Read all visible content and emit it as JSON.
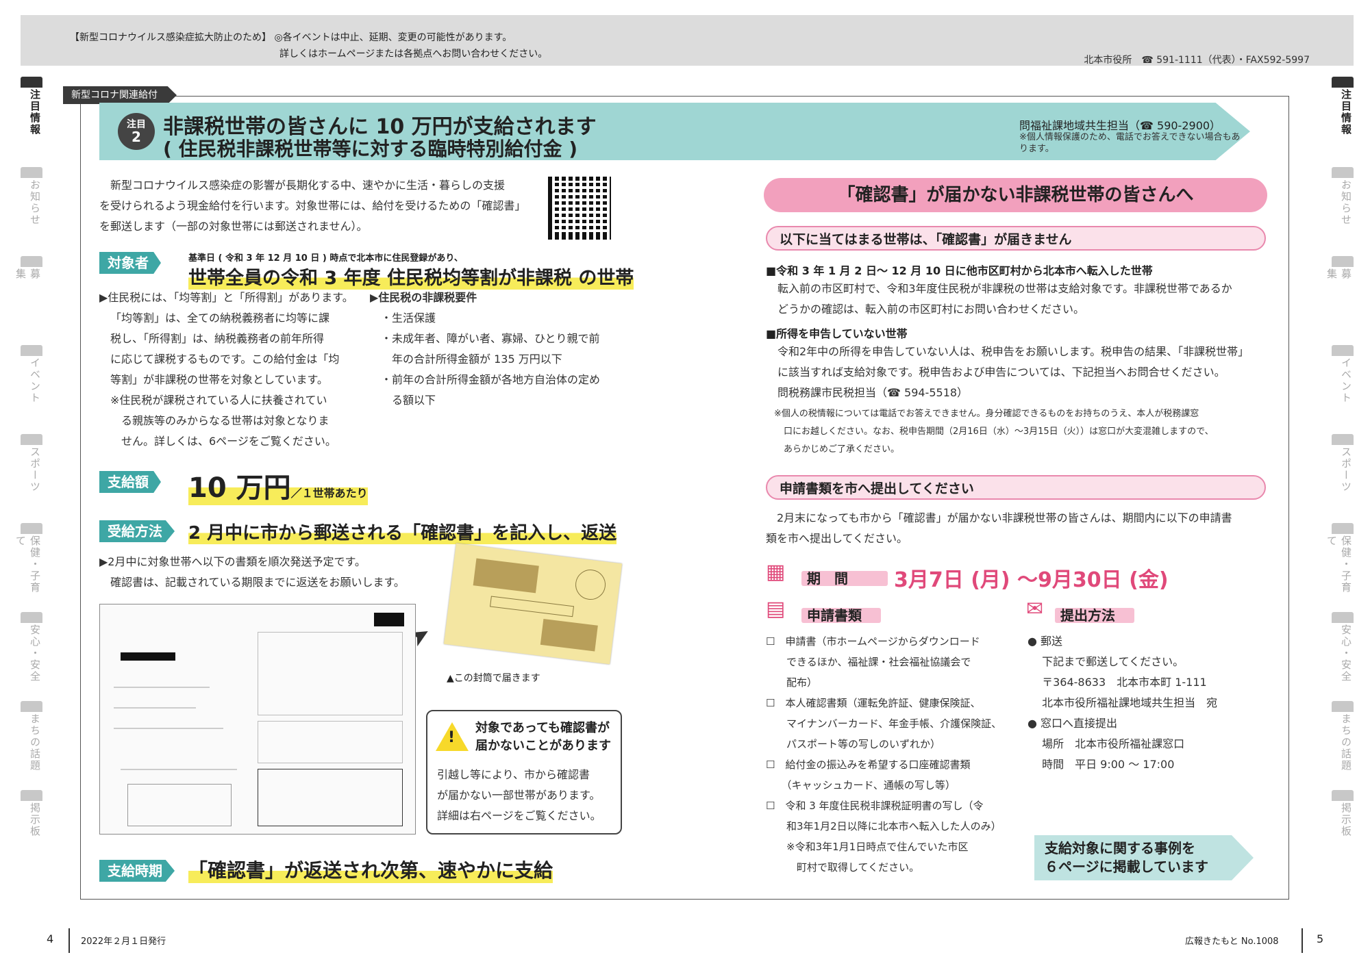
{
  "top_notice": {
    "line1": "【新型コロナウイルス感染症拡大防止のため】 ◎各イベントは中止、延期、変更の可能性があります。",
    "line2": "詳しくはホームページまたは各拠点へお問い合わせください。",
    "city_contact": "北本市役所　☎ 591-1111（代表）・FAX592-5997"
  },
  "side_tabs": [
    "注目情報",
    "お知らせ",
    "募集",
    "イベント",
    "スポーツ",
    "保健・子育て",
    "安心・安全",
    "まちの話題",
    "掲示板"
  ],
  "section_label": "新型コロナ関連給付",
  "header": {
    "badge_top": "注目",
    "badge_num": "2",
    "title1": "非課税世帯の皆さんに 10 万円が支給されます",
    "title2": "( 住民税非課税世帯等に対する臨時特別給付金 )",
    "contact": "問福祉課地域共生担当（☎ 590-2900）",
    "note": "※個人情報保護のため、電話でお答えできない場合もあります。"
  },
  "intro": {
    "line1": "新型コロナウイルス感染症の影響が長期化する中、速やかに生活・暮らしの支援",
    "line2": "を受けられるよう現金給付を行います。対象世帯には、給付を受けるための「確認書」",
    "line3": "を郵送します（一部の対象世帯には郵送されません）。"
  },
  "target": {
    "label": "対象者",
    "pre": "基準日 ( 令和 3 年 12 月 10 日 ) 時点で北本市に住民登録があり、",
    "main": "世帯全員の令和 3 年度 住民税均等割が非課税 の世帯",
    "left_lines": [
      "▶住民税には、「均等割」と「所得割」があります。",
      "「均等割」は、全ての納税義務者に均等に課",
      "税し、「所得割」は、納税義務者の前年所得",
      "に応じて課税するものです。この給付金は「均",
      "等割」が非課税の世帯を対象としています。",
      "※住民税が課税されている人に扶養されてい",
      "る親族等のみからなる世帯は対象となりま",
      "せん。詳しくは、6ページをご覧ください。"
    ],
    "req_title": "▶住民税の非課税要件",
    "req_lines": [
      "・生活保護",
      "・未成年者、障がい者、寡婦、ひとり親で前",
      "年の合計所得金額が 135 万円以下",
      "・前年の合計所得金額が各地方自治体の定め",
      "る額以下"
    ]
  },
  "amount": {
    "label": "支給額",
    "value": "10 万円",
    "unit": "／１世帯あたり"
  },
  "method": {
    "label": "受給方法",
    "main": "2 月中に市から郵送される「確認書」を記入し、返送",
    "line1": "▶2月中に対象世帯へ以下の書類を順次発送予定です。",
    "line2": "確認書は、記載されている期限までに返送をお願いします。",
    "envelope_caption": "▲この封筒で届きます"
  },
  "caution": {
    "title1": "対象であっても確認書が",
    "title2": "届かないことがあります",
    "line1": "引越し等により、市から確認書",
    "line2": "が届かない一部世帯があります。",
    "line3": "詳細は右ページをご覧ください。"
  },
  "timing": {
    "label": "支給時期",
    "main": "「確認書」が返送され次第、速やかに支給"
  },
  "right": {
    "pill": "「確認書」が届かない非課税世帯の皆さんへ",
    "sub1": "以下に当てはまる世帯は、「確認書」が届きません",
    "case1_title": "■令和 3 年 1 月 2 日～ 12 月 10 日に他市区町村から北本市へ転入した世帯",
    "case1_line1": "転入前の市区町村で、令和3年度住民税が非課税の世帯は支給対象です。非課税世帯であるか",
    "case1_line2": "どうかの確認は、転入前の市区町村にお問い合わせください。",
    "case2_title": "■所得を申告していない世帯",
    "case2_line1": "令和2年中の所得を申告していない人は、税申告をお願いします。税申告の結果、「非課税世帯」",
    "case2_line2": "に該当すれば支給対象です。税申告および申告については、下記担当へお問合せください。",
    "case2_contact": "問税務課市民税担当（☎ 594-5518）",
    "case2_note1": "※個人の税情報については電話でお答えできません。身分確認できるものをお持ちのうえ、本人が税務課窓",
    "case2_note2": "口にお越しください。なお、税申告期間（2月16日（水）～3月15日（火））は窓口が大変混雑しますので、",
    "case2_note3": "あらかじめご了承ください。",
    "sub2": "申請書類を市へ提出してください",
    "submit_line1": "2月末になっても市から「確認書」が届かない非課税世帯の皆さんは、期間内に以下の申請書",
    "submit_line2": "類を市へ提出してください。",
    "period_label": "期　間",
    "period_value": "3月7日 (月) ～9月30日 (金)",
    "docs_label": "申請書類",
    "docs": [
      "☐　申請書（市ホームページからダウンロード",
      "　　できるほか、福祉課・社会福祉協議会で",
      "　　配布）",
      "☐　本人確認書類（運転免許証、健康保険証、",
      "　　マイナンバーカード、年金手帳、介護保険証、",
      "　　パスポート等の写しのいずれか）",
      "☐　給付金の振込みを希望する口座確認書類",
      "　　（キャッシュカード、通帳の写し等）",
      "☐　令和 3 年度住民税非課税証明書の写し（令",
      "　　和3年1月2日以降に北本市へ転入した人のみ）",
      "　　※令和3年1月1日時点で住んでいた市区",
      "　　　町村で取得してください。"
    ],
    "method_label": "提出方法",
    "methods": [
      "●  郵送",
      "　 下記まで郵送してください。",
      "　 〒364-8633　北本市本町 1-111",
      "　 北本市役所福祉課地域共生担当　宛",
      "●  窓口へ直接提出",
      "　 場所　北本市役所福祉課窓口",
      "　 時間　平日 9:00 ～ 17:00"
    ],
    "ref1": "支給対象に関する事例を",
    "ref2": "６ページに掲載しています"
  },
  "footer": {
    "page_left": "4",
    "date": "2022年２月１日発行",
    "mag": "広報きたもと No.1008",
    "page_right": "5"
  }
}
